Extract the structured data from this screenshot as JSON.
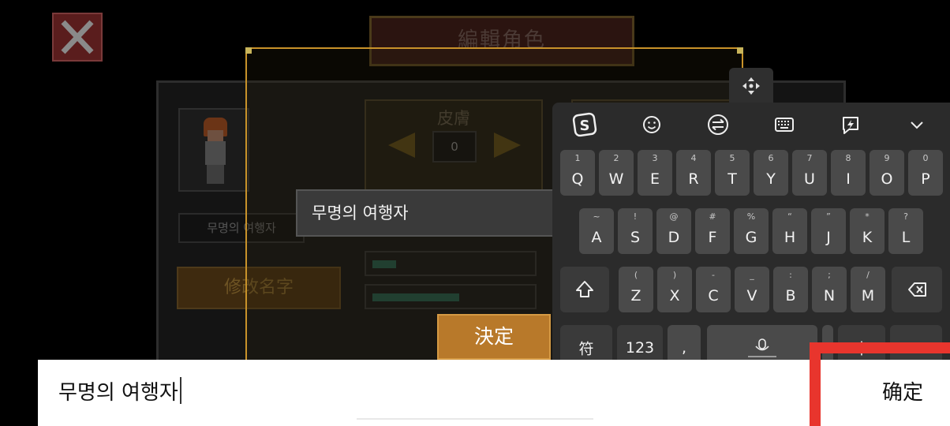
{
  "game": {
    "title": "編輯角色",
    "skin_label": "皮膚",
    "skin_value": "0",
    "name_field": "무명의 여행자",
    "rename_button": "修改名字",
    "name_input_value": "무명의 여행자",
    "confirm_button": "決定",
    "slider_1_level": 0.15,
    "slider_2_level": 0.55
  },
  "keyboard": {
    "toolbar_icons": [
      "sogou-logo-icon",
      "emoji-icon",
      "switch-icon",
      "keyboard-icon",
      "quick-phrase-icon",
      "chevron-down-icon"
    ],
    "row1": [
      {
        "main": "Q",
        "hint": "1"
      },
      {
        "main": "W",
        "hint": "2"
      },
      {
        "main": "E",
        "hint": "3"
      },
      {
        "main": "R",
        "hint": "4"
      },
      {
        "main": "T",
        "hint": "5"
      },
      {
        "main": "Y",
        "hint": "6"
      },
      {
        "main": "U",
        "hint": "7"
      },
      {
        "main": "I",
        "hint": "8"
      },
      {
        "main": "O",
        "hint": "9"
      },
      {
        "main": "P",
        "hint": "0"
      }
    ],
    "row2": [
      {
        "main": "A",
        "hint": "~"
      },
      {
        "main": "S",
        "hint": "!"
      },
      {
        "main": "D",
        "hint": "@"
      },
      {
        "main": "F",
        "hint": "#"
      },
      {
        "main": "G",
        "hint": "%"
      },
      {
        "main": "H",
        "hint": "“"
      },
      {
        "main": "J",
        "hint": "”"
      },
      {
        "main": "K",
        "hint": "*"
      },
      {
        "main": "L",
        "hint": "?"
      }
    ],
    "row3": [
      {
        "main": "Z",
        "hint": "("
      },
      {
        "main": "X",
        "hint": ")"
      },
      {
        "main": "C",
        "hint": "-"
      },
      {
        "main": "V",
        "hint": "_"
      },
      {
        "main": "B",
        "hint": ":"
      },
      {
        "main": "N",
        "hint": ";"
      },
      {
        "main": "M",
        "hint": "/"
      }
    ],
    "symbols_key": "符",
    "numbers_key": "123",
    "comma_key": ",",
    "lang_key": "中"
  },
  "input_bar": {
    "text": "무명의 여행자",
    "confirm": "确定"
  },
  "colors": {
    "highlight": "#e8352d",
    "game_button": "#b8792a",
    "frame": "#c8922a"
  }
}
